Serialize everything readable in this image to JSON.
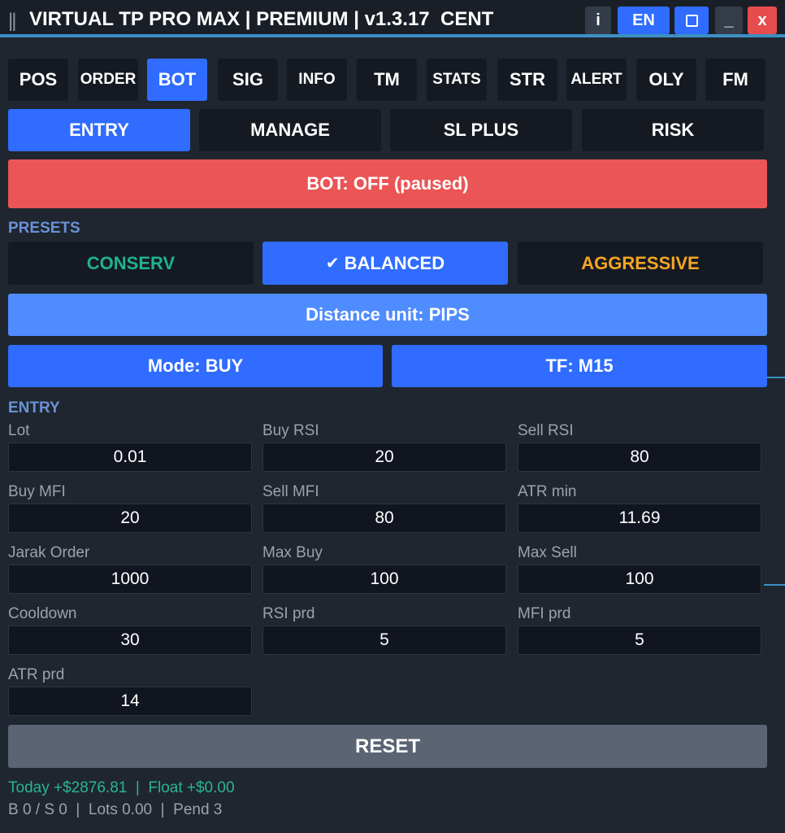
{
  "window": {
    "title": "VIRTUAL TP PRO MAX | PREMIUM | v1.3.17  CENT",
    "grip": "||",
    "info_label": "i",
    "lang_label": "EN",
    "minimize_label": "_",
    "close_label": "x"
  },
  "tabs": [
    "POS",
    "ORDER",
    "BOT",
    "SIG",
    "INFO",
    "TM",
    "STATS",
    "STR",
    "ALERT",
    "OLY",
    "FM"
  ],
  "active_tab": "BOT",
  "subtabs": [
    "ENTRY",
    "MANAGE",
    "SL PLUS",
    "RISK"
  ],
  "active_subtab": "ENTRY",
  "bot_status": "BOT: OFF (paused)",
  "presets": {
    "label": "PRESETS",
    "items": [
      {
        "label": "CONSERV",
        "color": "#21b38c"
      },
      {
        "label": "BALANCED",
        "color": "#ffffff"
      },
      {
        "label": "AGGRESSIVE",
        "color": "#f5a623"
      }
    ],
    "active": "BALANCED"
  },
  "distance_unit": "Distance unit: PIPS",
  "mode": "Mode: BUY",
  "tf": "TF: M15",
  "entry": {
    "label": "ENTRY",
    "fields": [
      {
        "label": "Lot",
        "value": "0.01"
      },
      {
        "label": "Buy RSI",
        "value": "20"
      },
      {
        "label": "Sell RSI",
        "value": "80"
      },
      {
        "label": "Buy MFI",
        "value": "20"
      },
      {
        "label": "Sell MFI",
        "value": "80"
      },
      {
        "label": "ATR min",
        "value": "11.69"
      },
      {
        "label": "Jarak Order",
        "value": "1000"
      },
      {
        "label": "Max Buy",
        "value": "100"
      },
      {
        "label": "Max Sell",
        "value": "100"
      },
      {
        "label": "Cooldown",
        "value": "30"
      },
      {
        "label": "RSI prd",
        "value": "5"
      },
      {
        "label": "MFI prd",
        "value": "5"
      },
      {
        "label": "ATR prd",
        "value": "14"
      }
    ]
  },
  "reset_label": "RESET",
  "footer": {
    "line1": "Today +$2876.81  |  Float +$0.00",
    "line2": "B 0 / S 0  |  Lots 0.00  |  Pend 3"
  },
  "colors": {
    "accent": "#2f6cff",
    "bot_off": "#eb5555",
    "distance_button": "#4f8cff",
    "reset": "#5a6473",
    "profit": "#2ab58f"
  }
}
